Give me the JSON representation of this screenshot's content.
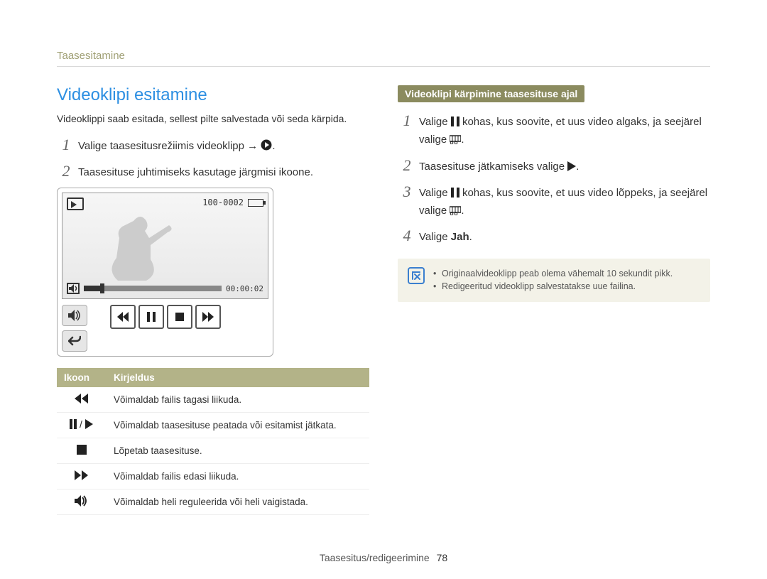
{
  "breadcrumb": "Taasesitamine",
  "section_title": "Videoklipi esitamine",
  "intro": "Videoklippi saab esitada, sellest pilte salvestada või seda kärpida.",
  "left_steps": {
    "s1": "Valige taasesitusrežiimis videoklipp → ",
    "s2": "Taasesituse juhtimiseks kasutage järgmisi ikoone."
  },
  "screen": {
    "file_counter": "100-0002",
    "timecode": "00:00:02"
  },
  "table": {
    "head_icon": "Ikoon",
    "head_desc": "Kirjeldus",
    "rows": [
      {
        "icon": "rewind",
        "desc": "Võimaldab failis tagasi liikuda."
      },
      {
        "icon": "pauseplay",
        "desc": "Võimaldab taasesituse peatada või esitamist jätkata."
      },
      {
        "icon": "stop",
        "desc": "Lõpetab taasesituse."
      },
      {
        "icon": "ffwd",
        "desc": "Võimaldab failis edasi liikuda."
      },
      {
        "icon": "volume",
        "desc": "Võimaldab heli reguleerida või heli vaigistada."
      }
    ]
  },
  "right": {
    "tag": "Videoklipi kärpimine taasesituse ajal",
    "s1a": "Valige ",
    "s1b": " kohas, kus soovite, et uus video algaks, ja seejärel valige ",
    "s2": "Taasesituse jätkamiseks valige ",
    "s3a": "Valige ",
    "s3b": " kohas, kus soovite, et uus video lõppeks, ja seejärel valige ",
    "s4a": "Valige ",
    "s4b": "Jah",
    "s4c": "."
  },
  "note": {
    "n1": "Originaalvideoklipp peab olema vähemalt 10 sekundit pikk.",
    "n2": "Redigeeritud videoklipp salvestatakse uue failina."
  },
  "footer": {
    "label": "Taasesitus/redigeerimine",
    "page": "78"
  }
}
